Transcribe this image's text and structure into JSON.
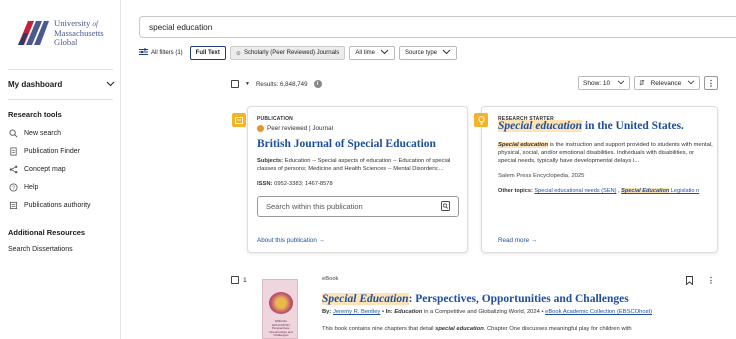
{
  "brand": {
    "line1": "University",
    "of": "of",
    "line2": "Massachusetts",
    "line3": "Global"
  },
  "sidebar": {
    "dashboard": "My dashboard",
    "research_tools_title": "Research tools",
    "items": [
      {
        "label": "New search",
        "icon": "search-icon"
      },
      {
        "label": "Publication Finder",
        "icon": "document-icon"
      },
      {
        "label": "Concept map",
        "icon": "concept-map-icon"
      },
      {
        "label": "Help",
        "icon": "help-icon"
      },
      {
        "label": "Publications authority",
        "icon": "authority-icon"
      }
    ],
    "additional_title": "Additional Resources",
    "additional_items": [
      {
        "label": "Search Dissertations"
      }
    ]
  },
  "search": {
    "query": "special education"
  },
  "filters": {
    "all_filters": "All filters (1)",
    "full_text": "Full Text",
    "scholarly": "Scholarly (Peer Reviewed) Journals",
    "all_time": "All time",
    "source_type": "Source type"
  },
  "results": {
    "count": "Results: 6,848,749",
    "show": "Show: 10",
    "sort": "Relevance"
  },
  "card_publication": {
    "eyebrow": "PUBLICATION",
    "status": "Peer reviewed | Journal",
    "title": "British Journal of Special Education",
    "subjects_label": "Subjects:",
    "subjects": "Education -- Special aspects of education -- Education of special classes of persons; Medicine and Health Sciences -- Mental Disorders;...",
    "issn_label": "ISSN:",
    "issn": "0952-3383; 1467-8578",
    "search_within": "Search within this publication",
    "link": "About this publication →"
  },
  "card_starter": {
    "eyebrow": "RESEARCH STARTER",
    "title_hl": "Special education",
    "title_rest": " in the United States.",
    "desc_hl": "Special education",
    "desc_rest": " is the instruction and support provided to students with mental, physical, social, and/or emotional disabilities. Individuals with disabilities, or special needs, typically have developmental delays i...",
    "source": "Salem Press Encyclopedia, 2025",
    "other_label": "Other topics:",
    "other_link1": "Special educational needs (SEN)",
    "other_sep": " , ",
    "other_link2_hl": "Special Education",
    "other_link2_rest": " Legislatio n",
    "link": "Read more →"
  },
  "result1": {
    "index": "1",
    "type": "eBook",
    "title_hl": "Special Education",
    "title_rest": ": Perspectives, Opportunities and Challenges",
    "by_label": "By:",
    "author": "Jeremy R. Bentley",
    "in_label": " • In:",
    "in_hl": "Education",
    "in_rest": " in a Competitive and Globalizing World, 2024 • ",
    "collection": "eBook Academic Collection (EBSCOhost)",
    "desc_pre": "This book contains nine chapters that detail ",
    "desc_hl": "special education",
    "desc_post": ". Chapter One discusses meaningful play for children with",
    "cover_text": "SPECIAL EDUCATION Perspectives, Opportunities and Challenges"
  },
  "colors": {
    "accent": "#1d4f9e",
    "highlight": "#fde3b6",
    "badge": "#f4b328",
    "peer": "#e8932c"
  }
}
